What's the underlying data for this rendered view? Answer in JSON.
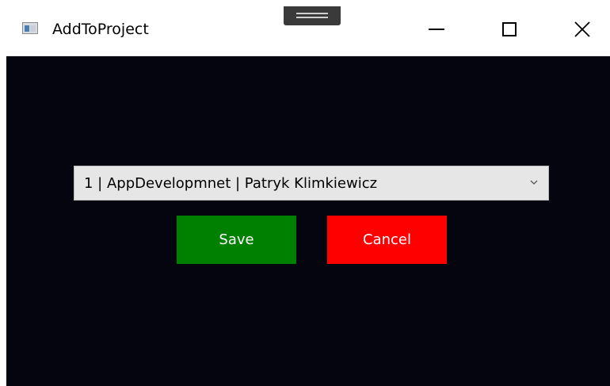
{
  "window": {
    "title": "AddToProject",
    "icon": "app-window-icon",
    "controls": {
      "minimize": "minimize-icon",
      "maximize": "maximize-icon",
      "close": "close-icon"
    }
  },
  "form": {
    "project_select": {
      "selected_value": "1 | AppDevelopmnet | Patryk Klimkiewicz"
    },
    "save_label": "Save",
    "cancel_label": "Cancel"
  },
  "colors": {
    "content_background": "#050510",
    "save_button": "#008000",
    "cancel_button": "#ff0000",
    "combo_background": "#e6e6e6"
  }
}
